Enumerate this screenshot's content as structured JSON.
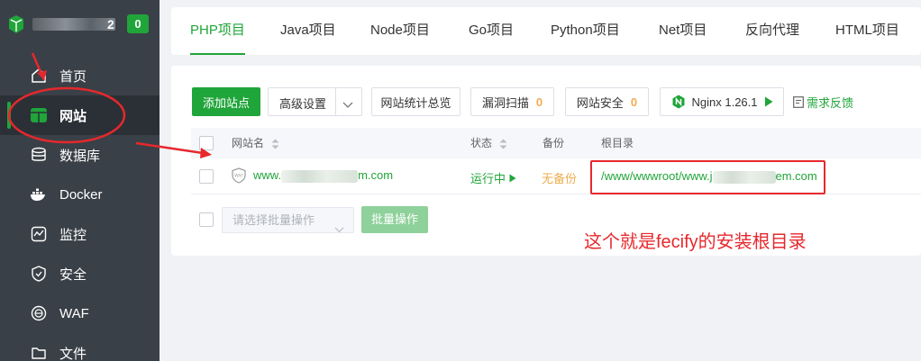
{
  "sidebar": {
    "username_suffix": "2",
    "badge": "0",
    "items": [
      {
        "label": "首页",
        "icon": "home-icon"
      },
      {
        "label": "网站",
        "icon": "globe-icon"
      },
      {
        "label": "数据库",
        "icon": "database-icon"
      },
      {
        "label": "Docker",
        "icon": "docker-icon"
      },
      {
        "label": "监控",
        "icon": "monitor-icon"
      },
      {
        "label": "安全",
        "icon": "shield-icon"
      },
      {
        "label": "WAF",
        "icon": "waf-icon"
      },
      {
        "label": "文件",
        "icon": "folder-icon"
      }
    ],
    "active_item": "网站"
  },
  "tabs": [
    "PHP项目",
    "Java项目",
    "Node项目",
    "Go项目",
    "Python项目",
    "Net项目",
    "反向代理",
    "HTML项目"
  ],
  "active_tab": "PHP项目",
  "toolbar": {
    "add_site": "添加站点",
    "advanced": "高级设置",
    "stats_overview": "网站统计总览",
    "vuln_scan": "漏洞扫描",
    "vuln_scan_count": "0",
    "site_security": "网站安全",
    "site_security_count": "0",
    "nginx": "Nginx 1.26.1",
    "feedback": "需求反馈"
  },
  "table": {
    "columns": [
      "网站名",
      "状态",
      "备份",
      "根目录"
    ],
    "rows": [
      {
        "name_prefix": "www.",
        "name_suffix": "m.com",
        "status": "运行中",
        "backup": "无备份",
        "root_prefix": "/www/wwwroot/www.j",
        "root_suffix": "em.com"
      }
    ]
  },
  "batch": {
    "placeholder": "请选择批量操作",
    "button": "批量操作"
  },
  "annotation": "这个就是fecify的安装根目录",
  "colors": {
    "accent": "#20a53a",
    "warning": "#f0ad4e",
    "sidebar_bg": "#3a4047",
    "annotation_red": "#e6282d"
  }
}
